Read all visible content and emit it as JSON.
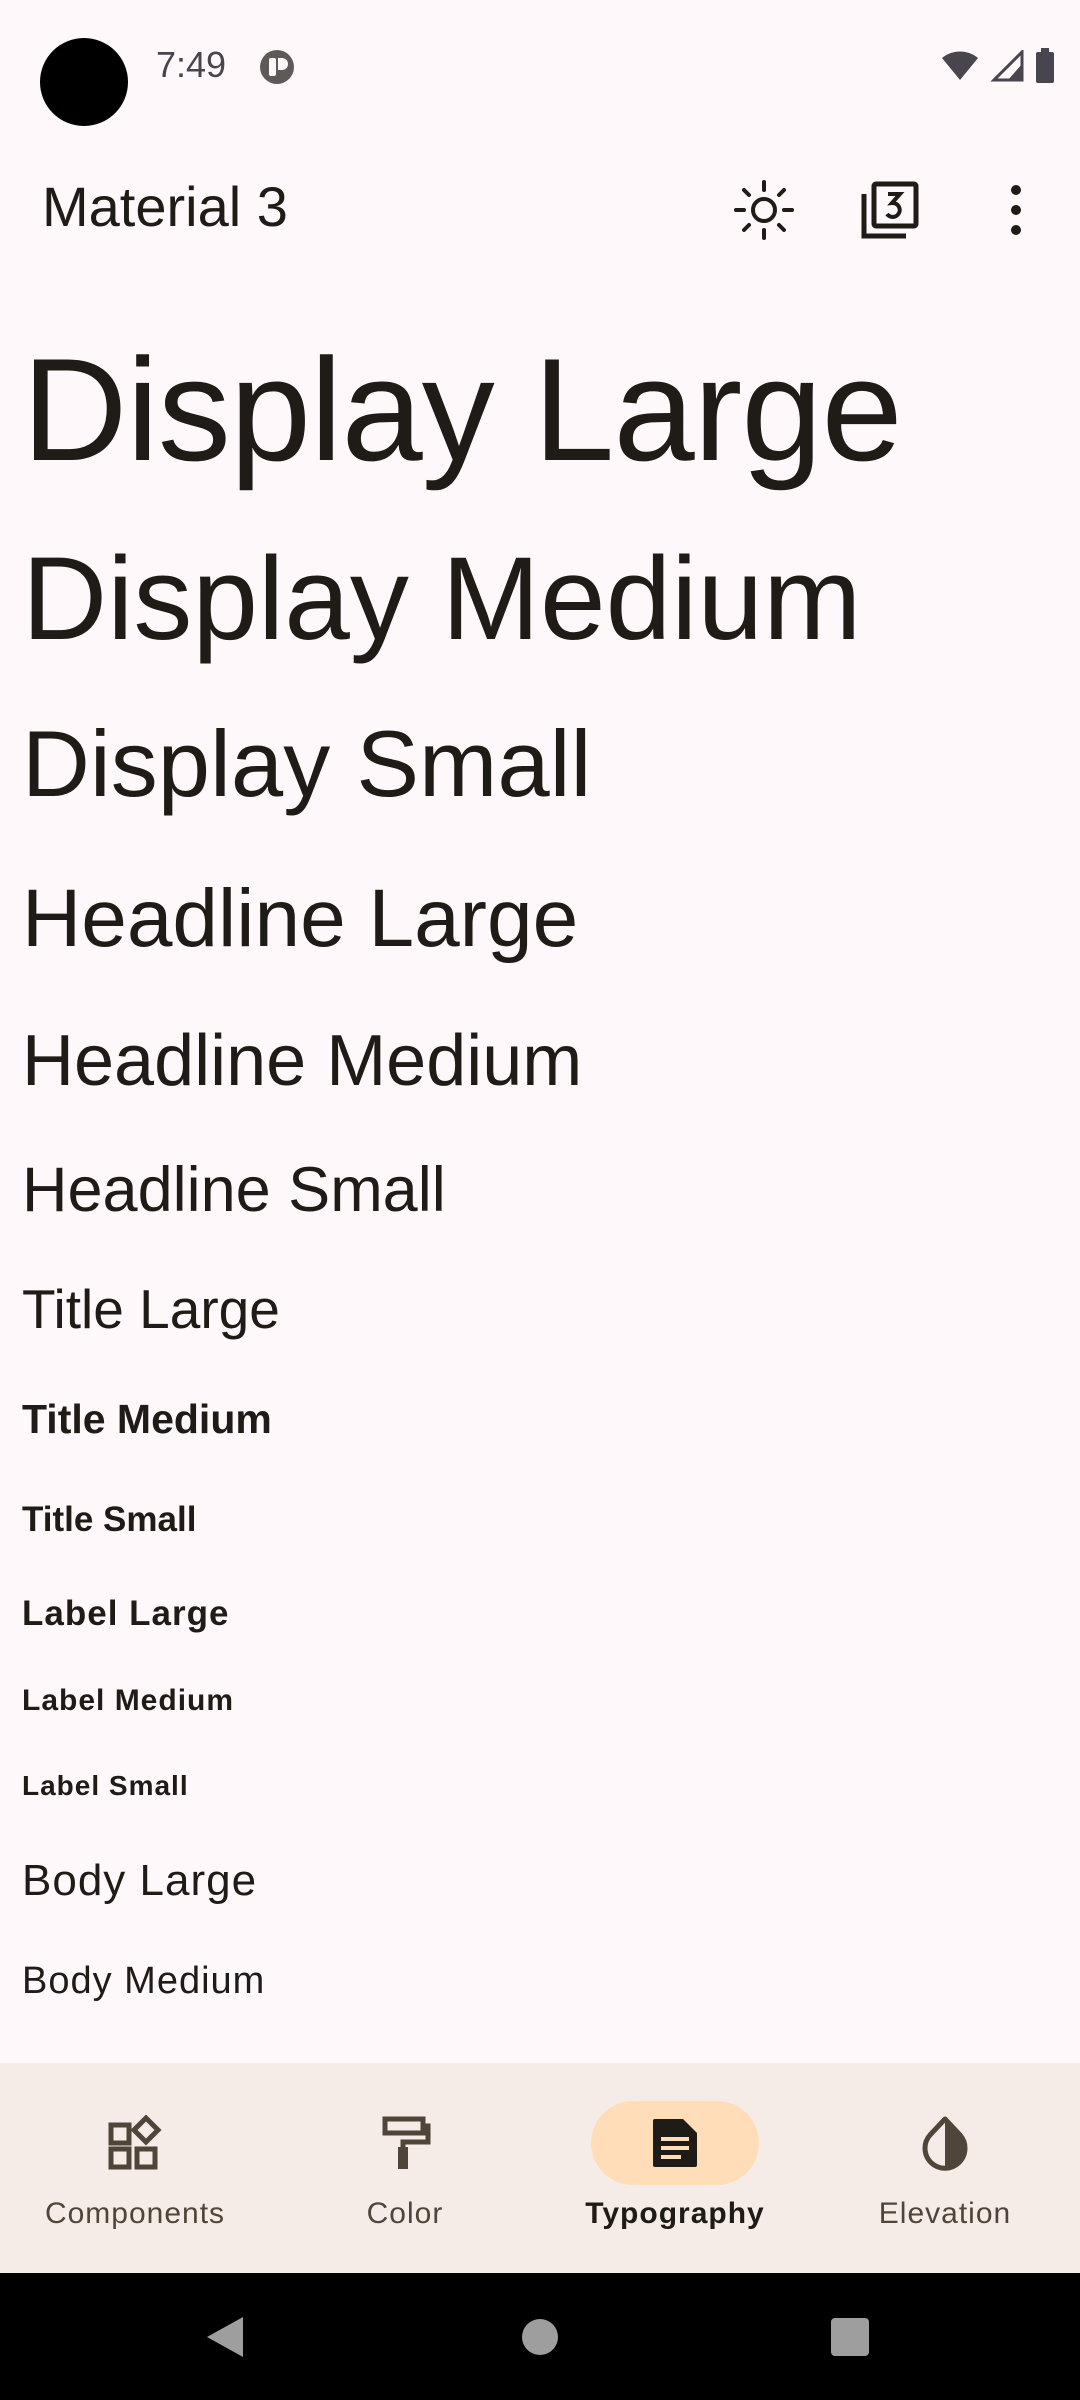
{
  "status_bar": {
    "time": "7:49"
  },
  "app_bar": {
    "title": "Material 3"
  },
  "typography": {
    "display_large": "Display Large",
    "display_medium": "Display Medium",
    "display_small": "Display Small",
    "headline_large": "Headline Large",
    "headline_medium": "Headline Medium",
    "headline_small": "Headline Small",
    "title_large": "Title Large",
    "title_medium": "Title Medium",
    "title_small": "Title Small",
    "label_large": "Label Large",
    "label_medium": "Label Medium",
    "label_small": "Label Small",
    "body_large": "Body Large",
    "body_medium": "Body Medium"
  },
  "bottom_nav": {
    "items": [
      {
        "label": "Components",
        "icon": "widgets-icon"
      },
      {
        "label": "Color",
        "icon": "format-paint-icon"
      },
      {
        "label": "Typography",
        "icon": "article-icon",
        "active": true
      },
      {
        "label": "Elevation",
        "icon": "opacity-icon"
      }
    ]
  },
  "colors": {
    "background": "#FFF8FA",
    "nav_background": "#F5ECE8",
    "active_indicator": "#FFDDB8",
    "on_surface": "#1F1B16"
  }
}
